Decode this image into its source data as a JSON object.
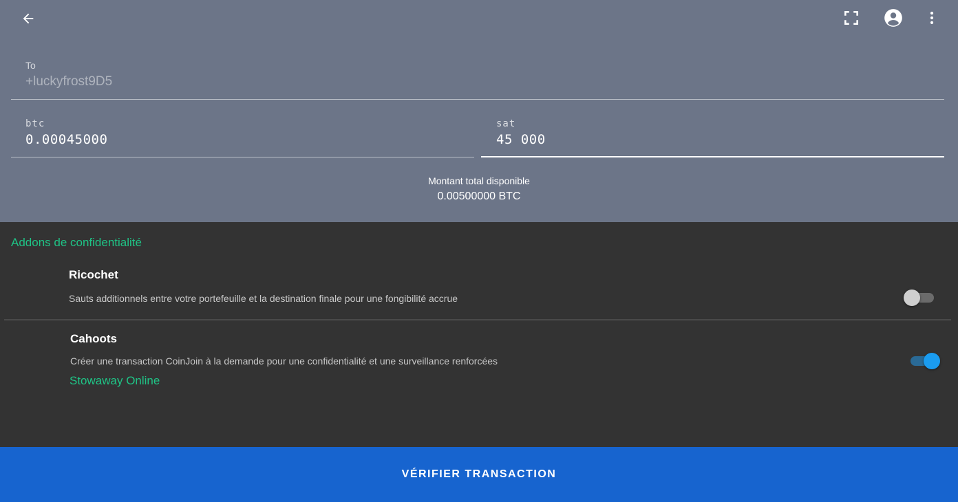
{
  "header": {
    "back_icon": "arrow-left-icon",
    "icons": [
      "fullscreen-icon",
      "account-circle-icon",
      "more-vert-icon"
    ]
  },
  "form": {
    "to_label": "To",
    "to_value": "+luckyfrost9D5",
    "btc_label": "btc",
    "btc_value": "0.00045000",
    "sat_label": "sat",
    "sat_value": "45 000"
  },
  "balance": {
    "label": "Montant total disponible",
    "value": "0.00500000 BTC"
  },
  "addons": {
    "section_title": "Addons de confidentialité",
    "ricochet": {
      "title": "Ricochet",
      "description": "Sauts additionnels entre votre portefeuille et la destination finale pour une fongibilité accrue",
      "enabled": false
    },
    "cahoots": {
      "title": "Cahoots",
      "description": "Créer une transaction CoinJoin à la demande pour une confidentialité et une surveillance renforcées",
      "selected_type": "Stowaway Online",
      "enabled": true
    }
  },
  "actions": {
    "verify_label": "VÉRIFIER TRANSACTION"
  },
  "colors": {
    "header_bg": "#6c7588",
    "content_bg": "#333333",
    "accent_green": "#1fc486",
    "button_blue": "#1764cf",
    "switch_on": "#1a9cf0"
  }
}
